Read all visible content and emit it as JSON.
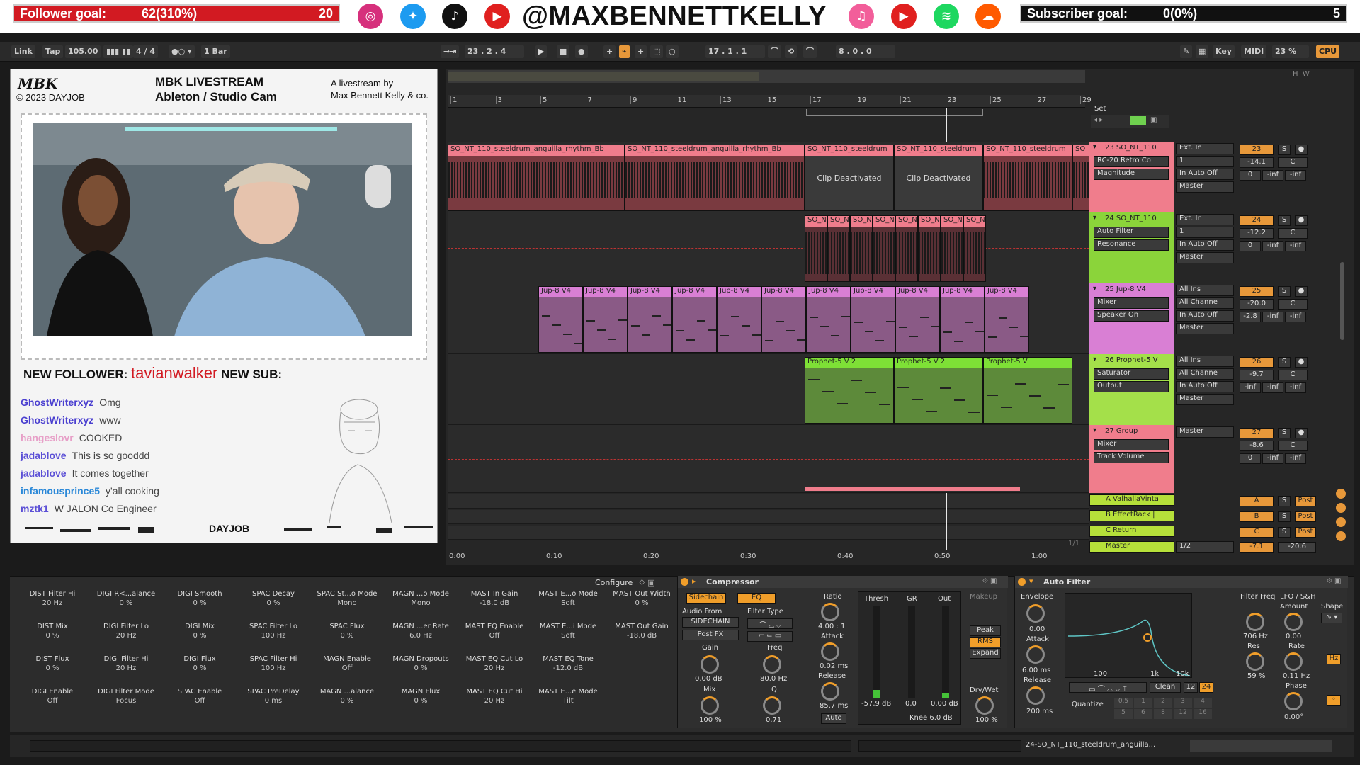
{
  "overlay_top": {
    "follower_goal": {
      "label": "Follower goal:",
      "value": "62(310%)",
      "target": "20",
      "fill": 1.0
    },
    "subscriber_goal": {
      "label": "Subscriber goal:",
      "value": "0(0%)",
      "target": "5",
      "fill": 0.0
    },
    "handle": "@MAXBENNETTKELLY",
    "socials": [
      "instagram-icon",
      "twitter-icon",
      "tiktok-icon",
      "youtube-icon",
      "apple-music-icon",
      "youtube-music-icon",
      "spotify-icon",
      "soundcloud-icon"
    ]
  },
  "transport": {
    "link": "Link",
    "tap": "Tap",
    "tempo": "105.00",
    "signature": "4 / 4",
    "quantize": "1 Bar",
    "position": "23 .  2 .  4",
    "loop_start": "17 .  1 .  1",
    "loop_length": "8 .  0 .  0",
    "key": "Key",
    "midi": "MIDI",
    "cpu_pct": "23 %",
    "cpu": "CPU"
  },
  "stream_panel": {
    "logo": "MBK",
    "copyright": "© 2023 DAYJOB",
    "title": "MBK LIVESTREAM",
    "subtitle": "Ableton / Studio Cam",
    "tagline1": "A livestream by",
    "tagline2": "Max Bennett Kelly & co.",
    "new_follower_label": "NEW FOLLOWER:",
    "new_follower_name": "tavianwalker",
    "new_sub_label": "NEW SUB:",
    "chat": [
      {
        "user": "GhostWriterxyz",
        "msg": "Omg",
        "color": "#4a3fd0"
      },
      {
        "user": "GhostWriterxyz",
        "msg": "www",
        "color": "#4a3fd0"
      },
      {
        "user": "hangeslovr",
        "msg": "COOKED",
        "color": "#e7a0c8"
      },
      {
        "user": "jadablove",
        "msg": "This is so gooddd",
        "color": "#5b4fd6"
      },
      {
        "user": "jadablove",
        "msg": "It comes together",
        "color": "#5b4fd6"
      },
      {
        "user": "infamousprince5",
        "msg": "y'all cooking",
        "color": "#2a88d8"
      },
      {
        "user": "mztk1",
        "msg": "W JALON Co Engineer",
        "color": "#5b4fd6"
      }
    ],
    "footer_logo": "DAYJOB"
  },
  "ruler": {
    "bars": [
      "1",
      "3",
      "5",
      "7",
      "9",
      "11",
      "13",
      "15",
      "17",
      "19",
      "21",
      "23",
      "25",
      "27",
      "29"
    ],
    "set": "Set",
    "time": [
      "0:00",
      "0:10",
      "0:20",
      "0:30",
      "0:40",
      "0:50",
      "1:00"
    ],
    "page": "1/1"
  },
  "tracks": [
    {
      "id": "23",
      "name": "23 SO_NT_110",
      "color": "#f07d8c",
      "input": "Ext. In",
      "ch": "1",
      "device": "RC-20 Retro Co",
      "param": "Magnitude",
      "out": "Master",
      "vol": "-14.1",
      "pan": "C",
      "send1": "0",
      "send2": "-inf",
      "send3": "-inf",
      "clips": [
        "SO_NT_110_steeldrum_anguilla_rhythm_Bb",
        "SO_NT_110_steeldrum_anguilla_rhythm_Bb",
        "SO_NT_110_steeldrum",
        "SO_NT_110_steeldrum",
        "SO_NT_110_steeldrum",
        "SO"
      ],
      "deact": "Clip Deactivated"
    },
    {
      "id": "24",
      "name": "24 SO_NT_110",
      "color": "#8bd43a",
      "input": "Ext. In",
      "ch": "1",
      "device": "Auto Filter",
      "param": "Resonance",
      "out": "Master",
      "vol": "-12.2",
      "pan": "C",
      "send1": "0",
      "send2": "-inf",
      "send3": "-inf",
      "clips": [
        "SO_N",
        "SO_N",
        "SO_N",
        "SO_N",
        "SO_N",
        "SO_N",
        "SO_N",
        "SO_N"
      ]
    },
    {
      "id": "25",
      "name": "25 Jup-8 V4",
      "color": "#d97fd4",
      "input": "All Ins",
      "ch": "All Channe",
      "device": "Mixer",
      "param": "Speaker On",
      "out": "Master",
      "vol": "-20.0",
      "pan": "C",
      "send1": "-2.8",
      "send2": "-inf",
      "send3": "-inf",
      "clips": [
        "Jup-8 V4",
        "Jup-8 V4",
        "Jup-8 V4",
        "Jup-8 V4",
        "Jup-8 V4",
        "Jup-8 V4",
        "Jup-8 V4",
        "Jup-8 V4",
        "Jup-8 V4",
        "Jup-8 V4",
        "Jup-8 V4"
      ]
    },
    {
      "id": "26",
      "name": "26 Prophet-5 V",
      "color": "#a4e04a",
      "input": "All Ins",
      "ch": "All Channe",
      "device": "Saturator",
      "param": "Output",
      "out": "Master",
      "vol": "-9.7",
      "pan": "C",
      "send1": "-inf",
      "send2": "-inf",
      "send3": "-inf",
      "clips": [
        "Prophet-5 V 2",
        "Prophet-5 V 2",
        "Prophet-5 V"
      ]
    },
    {
      "id": "27",
      "name": "27 Group",
      "color": "#f07d8c",
      "input": "Master",
      "device": "Mixer",
      "param": "Track Volume",
      "vol": "-8.6",
      "pan": "C",
      "send1": "0",
      "send2": "-inf",
      "send3": "-inf"
    }
  ],
  "returns": [
    {
      "name": "A ValhallaVinta",
      "letter": "A",
      "post": "Post"
    },
    {
      "name": "B EffectRack |",
      "letter": "B",
      "post": "Post"
    },
    {
      "name": "C Return",
      "letter": "C",
      "post": "Post"
    }
  ],
  "master": {
    "name": "Master",
    "cue": "1/2",
    "vol": "-7.1",
    "peak": "-20.6"
  },
  "macros": {
    "configure": "Configure",
    "items": [
      {
        "label": "DIST Filter Hi",
        "value": "20 Hz"
      },
      {
        "label": "DIGI R<...alance",
        "value": "0 %"
      },
      {
        "label": "DIGI Smooth",
        "value": "0 %"
      },
      {
        "label": "SPAC Decay",
        "value": "0 %"
      },
      {
        "label": "SPAC St...o Mode",
        "value": "Mono"
      },
      {
        "label": "MAGN ...o Mode",
        "value": "Mono"
      },
      {
        "label": "MAST In Gain",
        "value": "-18.0 dB"
      },
      {
        "label": "MAST E...o Mode",
        "value": "Soft"
      },
      {
        "label": "MAST Out Width",
        "value": "0 %"
      },
      {
        "label": "DIST Mix",
        "value": "0 %"
      },
      {
        "label": "DIGI Filter Lo",
        "value": "20 Hz"
      },
      {
        "label": "DIGI Mix",
        "value": "0 %"
      },
      {
        "label": "SPAC Filter Lo",
        "value": "100 Hz"
      },
      {
        "label": "SPAC Flux",
        "value": "0 %"
      },
      {
        "label": "MAGN ...er Rate",
        "value": "6.0 Hz"
      },
      {
        "label": "MAST EQ Enable",
        "value": "Off"
      },
      {
        "label": "MAST E...i Mode",
        "value": "Soft"
      },
      {
        "label": "MAST Out Gain",
        "value": "-18.0 dB"
      },
      {
        "label": "DIST Flux",
        "value": "0 %"
      },
      {
        "label": "DIGI Filter Hi",
        "value": "20 Hz"
      },
      {
        "label": "DIGI Flux",
        "value": "0 %"
      },
      {
        "label": "SPAC Filter Hi",
        "value": "100 Hz"
      },
      {
        "label": "MAGN Enable",
        "value": "Off"
      },
      {
        "label": "MAGN Dropouts",
        "value": "0 %"
      },
      {
        "label": "MAST EQ Cut Lo",
        "value": "20 Hz"
      },
      {
        "label": "MAST EQ Tone",
        "value": "-12.0 dB"
      },
      {
        "label": "DIGI Enable",
        "value": "Off"
      },
      {
        "label": "DIGI Filter Mode",
        "value": "Focus"
      },
      {
        "label": "SPAC Enable",
        "value": "Off"
      },
      {
        "label": "SPAC PreDelay",
        "value": "0 ms"
      },
      {
        "label": "MAGN ...alance",
        "value": "0 %"
      },
      {
        "label": "MAGN Flux",
        "value": "0 %"
      },
      {
        "label": "MAST EQ Cut Hi",
        "value": "20 Hz"
      },
      {
        "label": "MAST E...e Mode",
        "value": "Tilt"
      }
    ]
  },
  "compressor": {
    "title": "Compressor",
    "sidechain": "Sidechain",
    "eq": "EQ",
    "audio_from": "Audio From",
    "source": "SIDECHAIN",
    "tap": "Post FX",
    "gain_label": "Gain",
    "gain": "0.00 dB",
    "mix_label": "Mix",
    "mix": "100 %",
    "filter_type": "Filter Type",
    "freq_label": "Freq",
    "freq": "80.0 Hz",
    "q_label": "Q",
    "q": "0.71",
    "ratio_label": "Ratio",
    "ratio": "4.00 : 1",
    "attack_label": "Attack",
    "attack": "0.02 ms",
    "release_label": "Release",
    "release": "85.7 ms",
    "auto": "Auto",
    "thresh": "Thresh",
    "gr": "GR",
    "out": "Out",
    "thresh_val": "-57.9 dB",
    "gr_val": "0.0",
    "out_val": "0.00 dB",
    "knee": "Knee 6.0 dB",
    "makeup": "Makeup",
    "peak": "Peak",
    "rms": "RMS",
    "expand": "Expand",
    "drywet_label": "Dry/Wet",
    "drywet": "100 %"
  },
  "autofilter": {
    "title": "Auto Filter",
    "envelope": "Envelope",
    "env_amt": "0.00",
    "attack_label": "Attack",
    "attack": "6.00 ms",
    "release_label": "Release",
    "release": "200 ms",
    "freq_label": "Filter Freq",
    "freq": "706 Hz",
    "res_label": "Res",
    "res": "59 %",
    "lfo": "LFO / S&H",
    "amount_label": "Amount",
    "amount": "0.00",
    "rate_label": "Rate",
    "rate": "0.11 Hz",
    "shape": "Shape",
    "phase_label": "Phase",
    "phase": "0.00°",
    "clean": "Clean",
    "db12": "12",
    "db24": "24",
    "quantize": "Quantize",
    "q_vals": [
      "0.5",
      "1",
      "2",
      "3",
      "4",
      "5",
      "6",
      "8",
      "12",
      "16"
    ],
    "axis": [
      "100",
      "1k",
      "10k"
    ]
  },
  "status": {
    "clip_name": "24-SO_NT_110_steeldrum_anguilla..."
  }
}
